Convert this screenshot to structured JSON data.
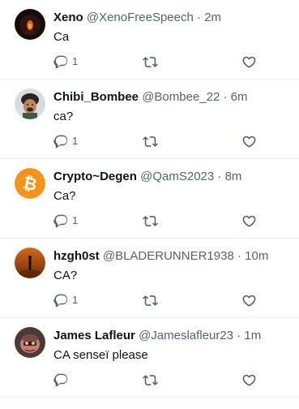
{
  "tweets": [
    {
      "name": "Xeno",
      "handle": "@XenoFreeSpeech",
      "sep": "·",
      "time": "2m",
      "text": "Ca",
      "reply_count": "1",
      "avatar": "xeno-avatar"
    },
    {
      "name": "Chibi_Bombee",
      "handle": "@Bombee_22",
      "sep": "·",
      "time": "6m",
      "text": "ca?",
      "reply_count": "1",
      "avatar": "chibi-avatar"
    },
    {
      "name": "Crypto~Degen",
      "handle": "@QamS2023",
      "sep": "·",
      "time": "8m",
      "text": "Ca?",
      "reply_count": "1",
      "avatar": "bitcoin-avatar"
    },
    {
      "name": "hzgh0st",
      "handle": "@BLADERUNNER1938",
      "sep": "·",
      "time": "10m",
      "text": "CA?",
      "reply_count": "1",
      "avatar": "hzgh0st-avatar"
    },
    {
      "name": "James Lafleur",
      "handle": "@Jameslafleur23",
      "sep": "·",
      "time": "1m",
      "text": "CA senseï please",
      "reply_count": "",
      "avatar": "james-avatar"
    }
  ],
  "icons": {
    "reply": "reply-icon",
    "retweet": "retweet-icon",
    "like": "like-icon"
  },
  "colors": {
    "text": "#0f1419",
    "secondary": "#536471",
    "divider": "#eff3f4",
    "bitcoin": "#f7931a"
  }
}
